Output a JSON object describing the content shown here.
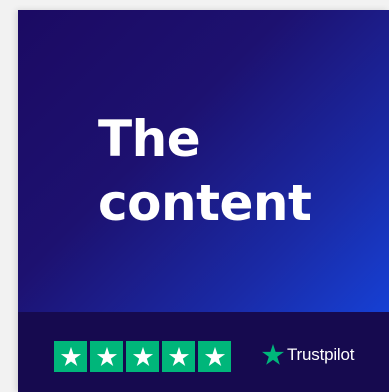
{
  "hero": {
    "title_line1": "The",
    "title_line2": "content"
  },
  "rating": {
    "stars_filled": 5,
    "stars_total": 5,
    "star_box_color": "#00b67a",
    "star_color": "#ffffff"
  },
  "brand": {
    "name": "Trustpilot",
    "icon": "trustpilot-star-icon",
    "icon_color": "#00b67a"
  },
  "colors": {
    "hero_gradient_start": "#1b0a63",
    "hero_gradient_end": "#1640d4",
    "footer_background": "#160a4f",
    "text": "#ffffff"
  }
}
